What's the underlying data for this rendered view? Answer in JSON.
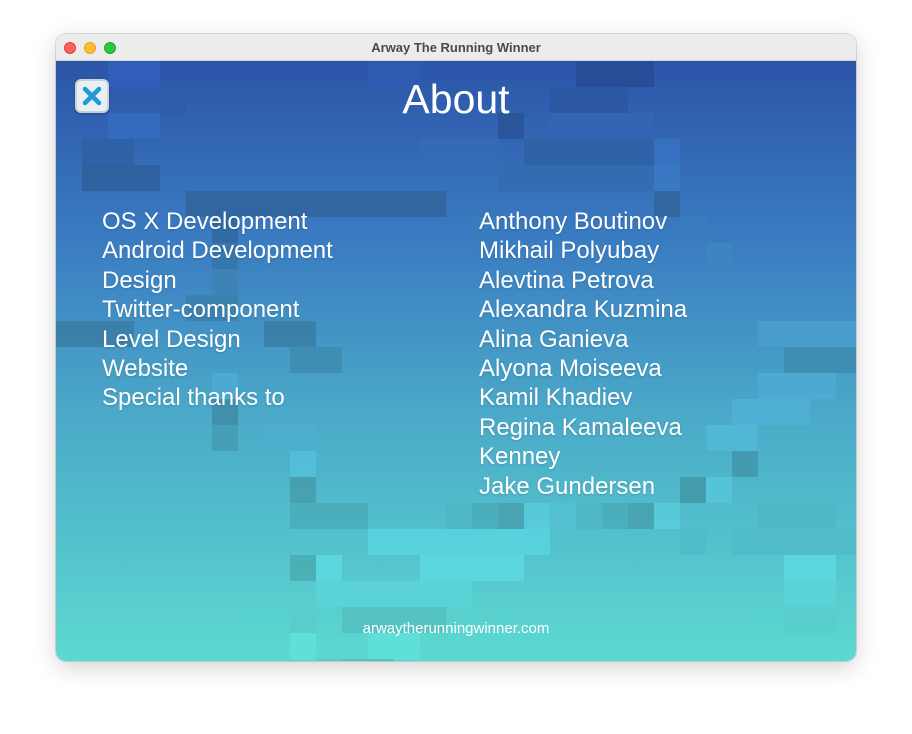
{
  "window": {
    "title": "Arway The Running Winner"
  },
  "header": {
    "title": "About"
  },
  "credits": {
    "roles": [
      "OS X Development",
      "Android Development",
      "Design",
      "Twitter-component",
      "Level Design",
      "Website",
      "Special thanks to"
    ],
    "names": [
      "Anthony Boutinov",
      "Mikhail Polyubay",
      "Alevtina Petrova",
      "Alexandra Kuzmina",
      "Alina Ganieva",
      "Alyona Moiseeva",
      "Kamil Khadiev",
      "Regina Kamaleeva",
      "Kenney",
      "Jake Gundersen"
    ]
  },
  "footer": {
    "website": "arwaytherunningwinner.com"
  },
  "colors": {
    "gradient_top": "#2c55a8",
    "gradient_bottom": "#5cd9d0",
    "close_icon": "#1e9ad6",
    "text": "#ffffff"
  },
  "icons": {
    "close": "close-icon"
  }
}
